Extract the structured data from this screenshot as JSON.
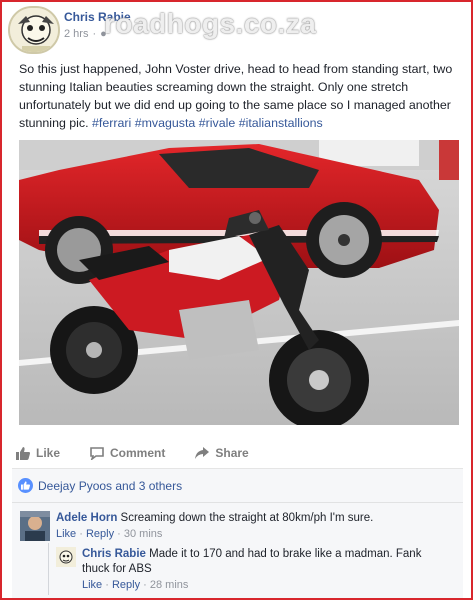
{
  "post": {
    "author": "Chris Rabie",
    "time": "2 hrs",
    "watermark": "roadhogs.co.za",
    "text_before": "So this just happened, John Voster drive, head to head from standing start, two stunning Italian beauties screaming down the straight. Only one stretch unfortunately but we did end up going to the same place so I managed another stunning pic. ",
    "hashtags": "#ferrari #mvagusta #rivale #italianstallions"
  },
  "actions": {
    "like": "Like",
    "comment": "Comment",
    "share": "Share"
  },
  "reactions": {
    "text": "Deejay Pyoos and 3 others"
  },
  "comments": [
    {
      "name": "Adele Horn",
      "text": "Screaming down the straight at 80km/ph I'm sure.",
      "like": "Like",
      "reply": "Reply",
      "time": "30 mins"
    },
    {
      "name": "Chris Rabie",
      "text_line1": "Made it to 170 and had to brake like a madman. Fank",
      "text_line2": "thuck for ABS",
      "like": "Like",
      "reply": "Reply",
      "time": "28 mins"
    }
  ],
  "colors": {
    "link": "#365899",
    "frame": "#d8262d",
    "muted": "#90949c",
    "like_badge": "#5890ff"
  }
}
